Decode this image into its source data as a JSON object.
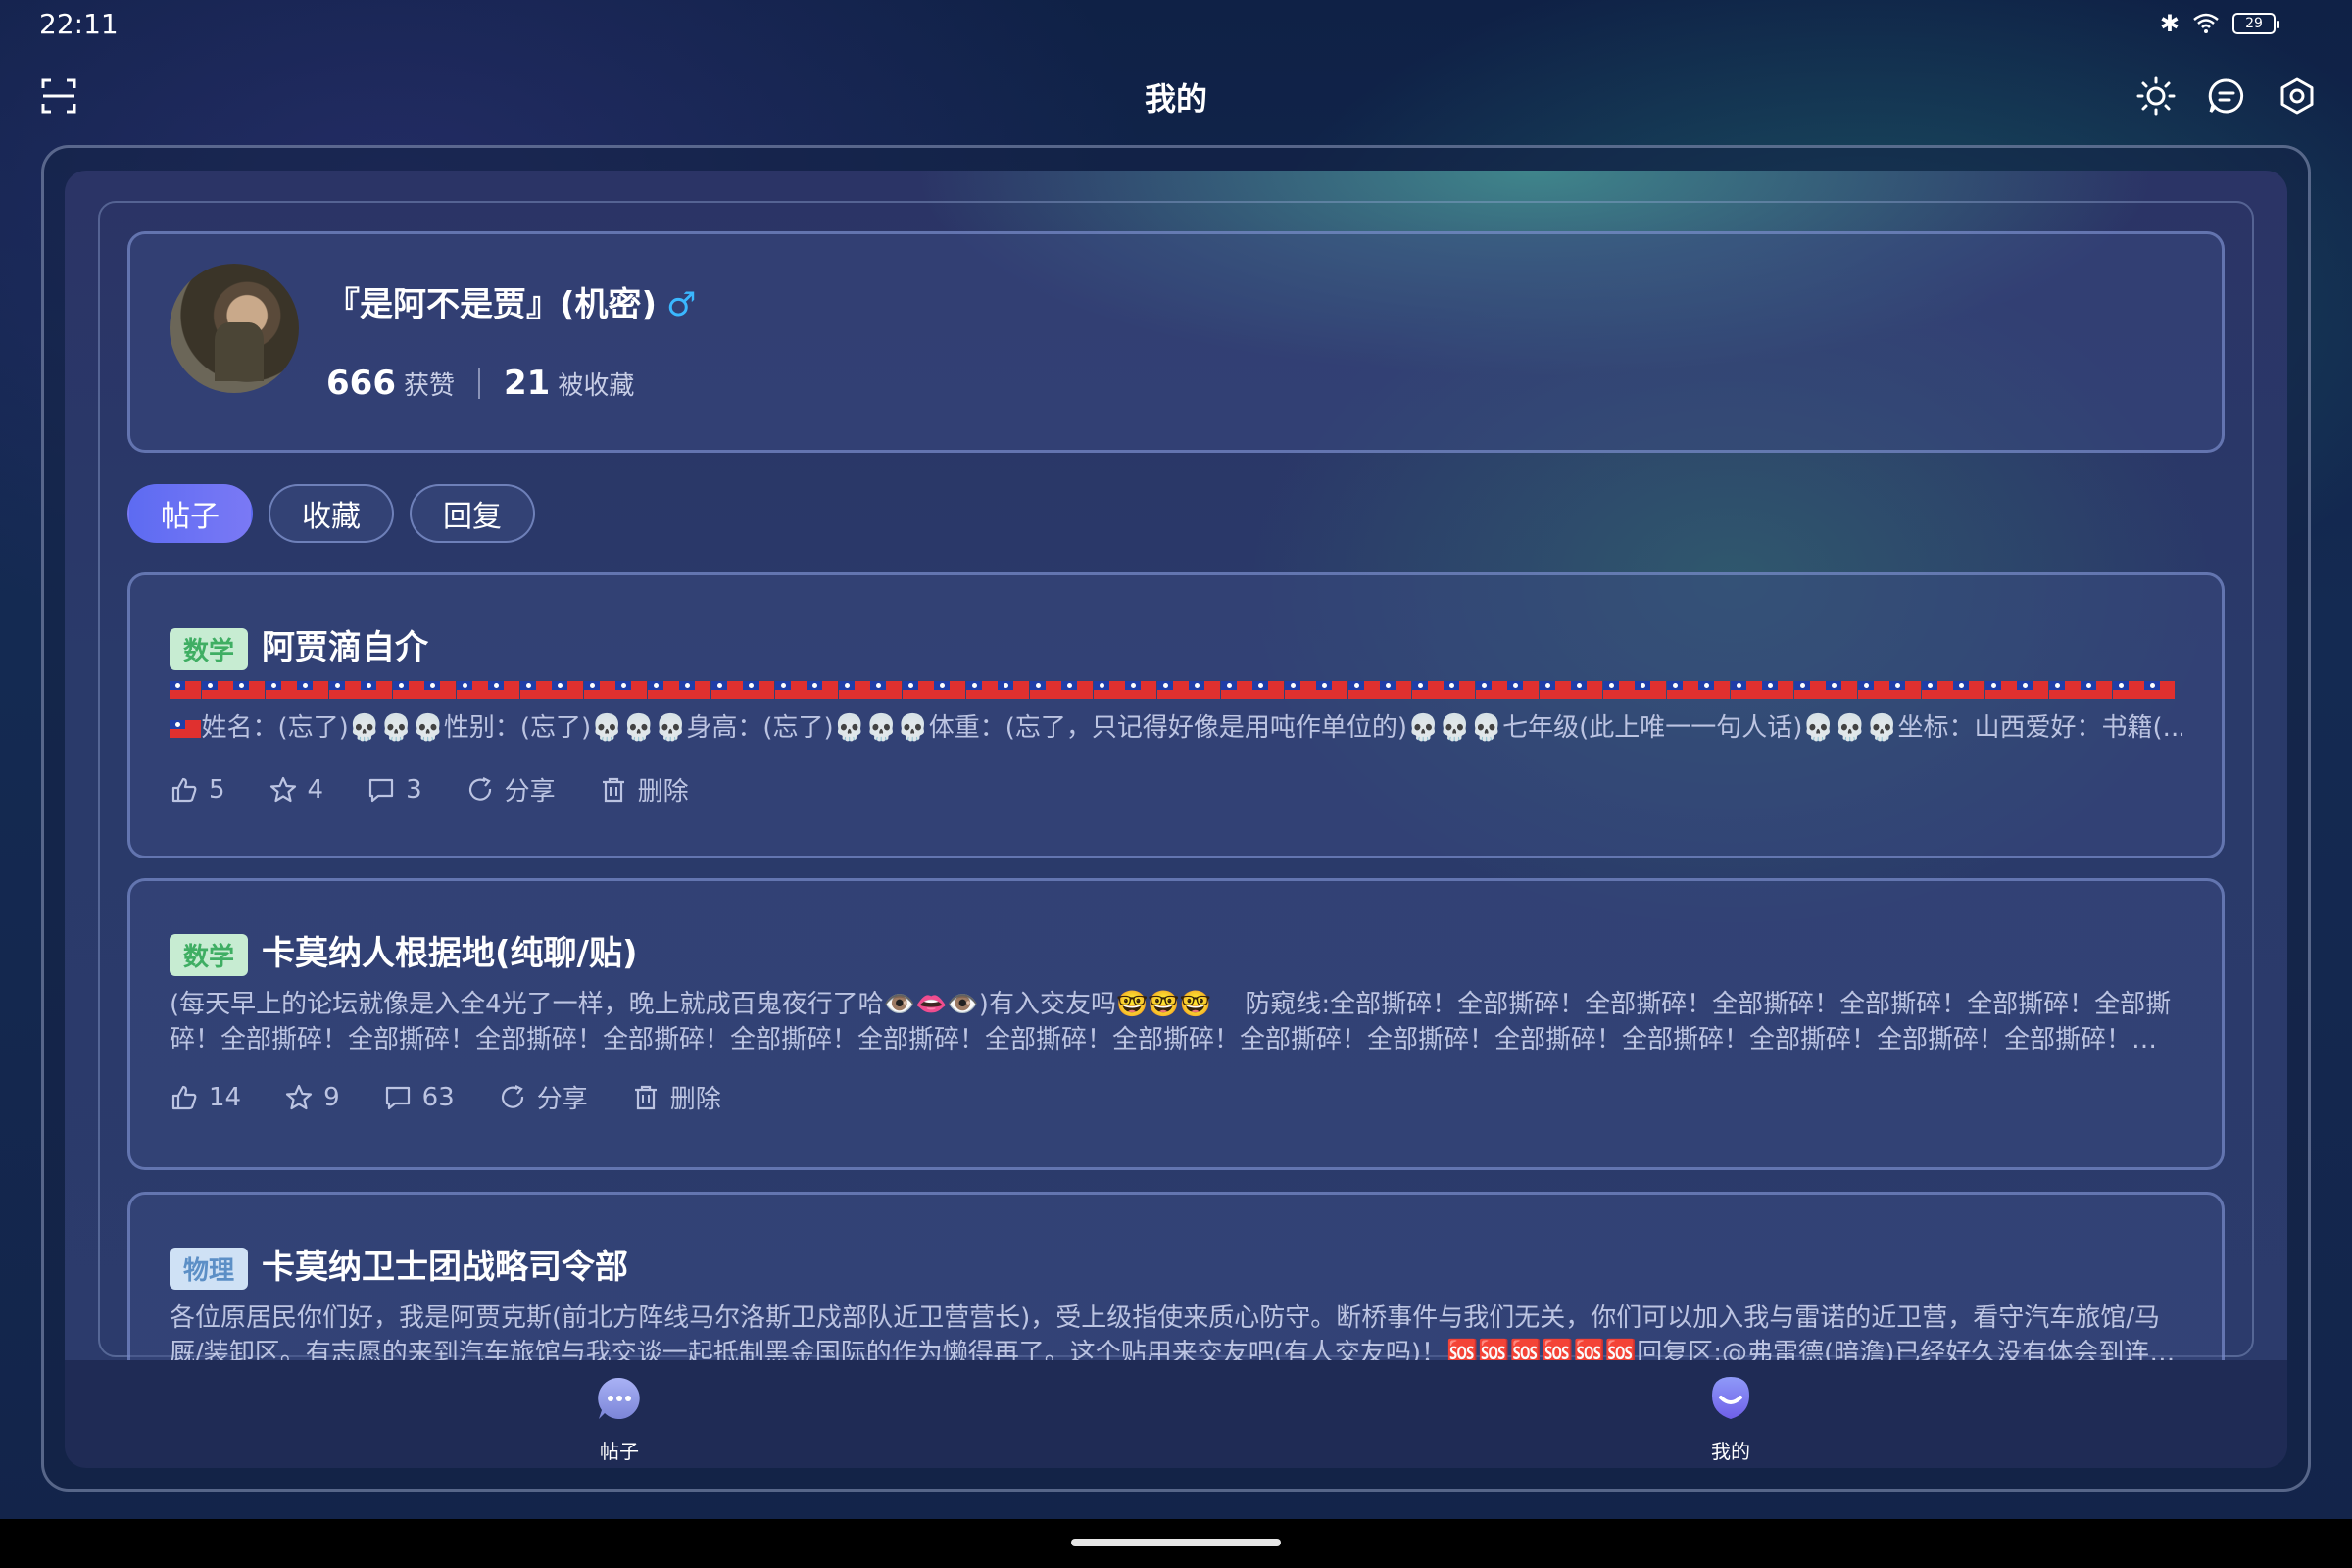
{
  "status_bar": {
    "time": "22:11",
    "battery": "29"
  },
  "header": {
    "title": "我的"
  },
  "profile": {
    "username": "『是阿不是贾』(机密)",
    "gender_symbol": "♂",
    "likes_count": "666",
    "likes_label": "获赞",
    "favorited_count": "21",
    "favorited_label": "被收藏"
  },
  "tabs": [
    {
      "label": "帖子",
      "active": true
    },
    {
      "label": "收藏",
      "active": false
    },
    {
      "label": "回复",
      "active": false
    }
  ],
  "posts": [
    {
      "tag": "数学",
      "title": "阿贾滴自介",
      "body_line2": "姓名：(忘了)💀💀💀性别：(忘了)💀💀💀身高：(忘了)💀💀💀体重：(忘了，只记得好像是用吨作单位的)💀💀💀七年级(此上唯一一句人话)💀💀💀坐标：山西爱好：书籍(...",
      "likes": "5",
      "favorites": "4",
      "comments": "3",
      "share_label": "分享",
      "delete_label": "删除"
    },
    {
      "tag": "数学",
      "title": "卡莫纳人根据地(纯聊/贴)",
      "body_line1": "(每天早上的论坛就像是入全4光了一样，晚上就成百鬼夜行了哈👁️👄👁️)有入交友吗🤓🤓🤓　 防窥线:全部撕碎！全部撕碎！全部撕碎！全部撕碎！全部撕碎！全部撕碎！全部撕",
      "body_line2": "碎！全部撕碎！全部撕碎！全部撕碎！全部撕碎！全部撕碎！全部撕碎！全部撕碎！全部撕碎！全部撕碎！全部撕碎！全部撕碎！全部撕碎！全部撕碎！全部撕碎！全部撕碎！…",
      "likes": "14",
      "favorites": "9",
      "comments": "63",
      "share_label": "分享",
      "delete_label": "删除"
    },
    {
      "tag": "物理",
      "title": "卡莫纳卫士团战略司令部",
      "body_line1": "各位原居民你们好，我是阿贾克斯(前北方阵线马尔洛斯卫戍部队近卫营营长)，受上级指使来质心防守。断桥事件与我们无关，你们可以加入我与雷诺的近卫营，看守汽车旅馆/马",
      "body_line2": "厩/装卸区。有志愿的来到汽车旅馆与我交谈一起抵制黑金国际的作为懒得再了。这个贴用来交友吧(有人交友吗)！🆘🆘🆘🆘🆘🆘回复区:@弗雷德(暗澹)已经好久没有体会到连…"
    }
  ],
  "bottom_nav": [
    {
      "label": "帖子"
    },
    {
      "label": "我的"
    }
  ]
}
